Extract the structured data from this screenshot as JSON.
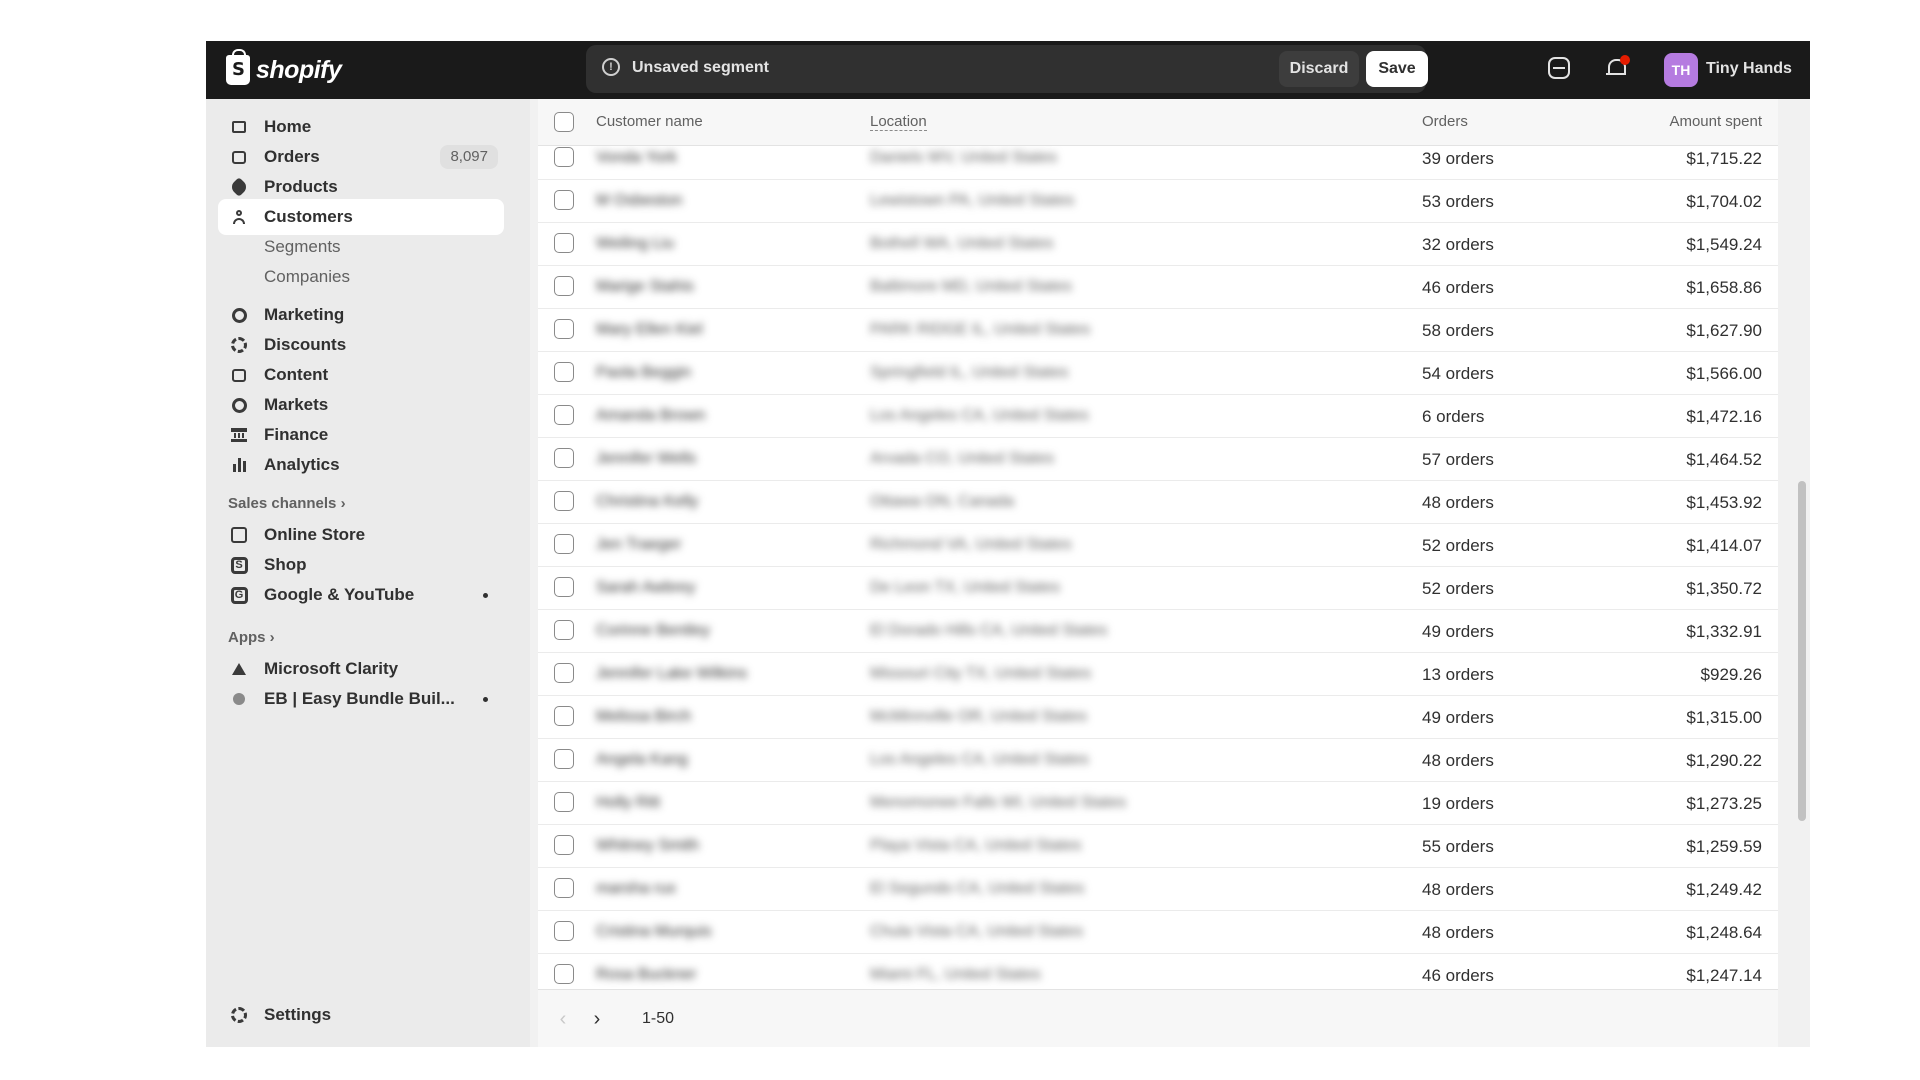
{
  "topbar": {
    "logo_text": "shopify",
    "segment_status": "Unsaved segment",
    "discard_label": "Discard",
    "save_label": "Save",
    "avatar_initials": "TH",
    "store_name": "Tiny Hands",
    "icons": [
      "info-icon",
      "help-icon",
      "bell-icon"
    ],
    "accent": "#b57be0"
  },
  "sidebar": {
    "items": [
      {
        "label": "Home",
        "icon": "home-icon"
      },
      {
        "label": "Orders",
        "icon": "orders-icon",
        "badge": "8,097"
      },
      {
        "label": "Products",
        "icon": "tag-icon"
      },
      {
        "label": "Customers",
        "icon": "person-icon",
        "active": true
      },
      {
        "label": "Segments"
      },
      {
        "label": "Companies"
      },
      {
        "label": "Marketing",
        "icon": "target-icon"
      },
      {
        "label": "Discounts",
        "icon": "discount-icon"
      },
      {
        "label": "Content",
        "icon": "content-icon"
      },
      {
        "label": "Markets",
        "icon": "globe-icon"
      },
      {
        "label": "Finance",
        "icon": "bank-icon"
      },
      {
        "label": "Analytics",
        "icon": "bar-chart-icon"
      }
    ],
    "sales_channels_label": "Sales channels",
    "channels": [
      {
        "label": "Online Store",
        "icon": "store-icon"
      },
      {
        "label": "Shop",
        "icon": "shop-icon"
      },
      {
        "label": "Google & YouTube",
        "icon": "google-icon"
      }
    ],
    "apps_label": "Apps",
    "apps": [
      {
        "label": "Microsoft Clarity",
        "icon": "clarity-icon"
      },
      {
        "label": "EB | Easy Bundle Buil...",
        "icon": "bundle-icon"
      }
    ],
    "settings_label": "Settings"
  },
  "table": {
    "headers": {
      "name": "Customer name",
      "location": "Location",
      "orders": "Orders",
      "amount": "Amount spent"
    },
    "rows": [
      {
        "name": "Vonda York",
        "location": "Daniels WV, United States",
        "orders": "39 orders",
        "amount": "$1,715.22"
      },
      {
        "name": "M Osbeston",
        "location": "Lewistown PA, United States",
        "orders": "53 orders",
        "amount": "$1,704.02"
      },
      {
        "name": "Weiling Liu",
        "location": "Bothell WA, United States",
        "orders": "32 orders",
        "amount": "$1,549.24"
      },
      {
        "name": "Marige Stahis",
        "location": "Baltimore MD, United States",
        "orders": "46 orders",
        "amount": "$1,658.86"
      },
      {
        "name": "Mary Ellen Kiel",
        "location": "PARK RIDGE IL, United States",
        "orders": "58 orders",
        "amount": "$1,627.90"
      },
      {
        "name": "Paola Beggin",
        "location": "Springfield IL, United States",
        "orders": "54 orders",
        "amount": "$1,566.00"
      },
      {
        "name": "Amanda Brown",
        "location": "Los Angeles CA, United States",
        "orders": "6 orders",
        "amount": "$1,472.16"
      },
      {
        "name": "Jennifer Wells",
        "location": "Arvada CO, United States",
        "orders": "57 orders",
        "amount": "$1,464.52"
      },
      {
        "name": "Christina Kelly",
        "location": "Ottawa ON, Canada",
        "orders": "48 orders",
        "amount": "$1,453.92"
      },
      {
        "name": "Jen Traeger",
        "location": "Richmond VA, United States",
        "orders": "52 orders",
        "amount": "$1,414.07"
      },
      {
        "name": "Sarah Awbrey",
        "location": "De Leon TX, United States",
        "orders": "52 orders",
        "amount": "$1,350.72"
      },
      {
        "name": "Corinne Bentley",
        "location": "El Dorado Hills CA, United States",
        "orders": "49 orders",
        "amount": "$1,332.91"
      },
      {
        "name": "Jennifer Lake Wilkins",
        "location": "Missouri City TX, United States",
        "orders": "13 orders",
        "amount": "$929.26"
      },
      {
        "name": "Melissa Birch",
        "location": "McMinnville OR, United States",
        "orders": "49 orders",
        "amount": "$1,315.00"
      },
      {
        "name": "Angela Kang",
        "location": "Los Angeles CA, United States",
        "orders": "48 orders",
        "amount": "$1,290.22"
      },
      {
        "name": "Holly Ritt",
        "location": "Menomonee Falls WI, United States",
        "orders": "19 orders",
        "amount": "$1,273.25"
      },
      {
        "name": "Whitney Smith",
        "location": "Playa Vista CA, United States",
        "orders": "55 orders",
        "amount": "$1,259.59"
      },
      {
        "name": "marsha rux",
        "location": "El Segundo CA, United States",
        "orders": "48 orders",
        "amount": "$1,249.42"
      },
      {
        "name": "Cristina Murquis",
        "location": "Chula Vista CA, United States",
        "orders": "48 orders",
        "amount": "$1,248.64"
      },
      {
        "name": "Rosa Buckner",
        "location": "Miami FL, United States",
        "orders": "46 orders",
        "amount": "$1,247.14"
      }
    ]
  },
  "pager": {
    "prev": "‹",
    "next": "›",
    "range": "1-50"
  }
}
